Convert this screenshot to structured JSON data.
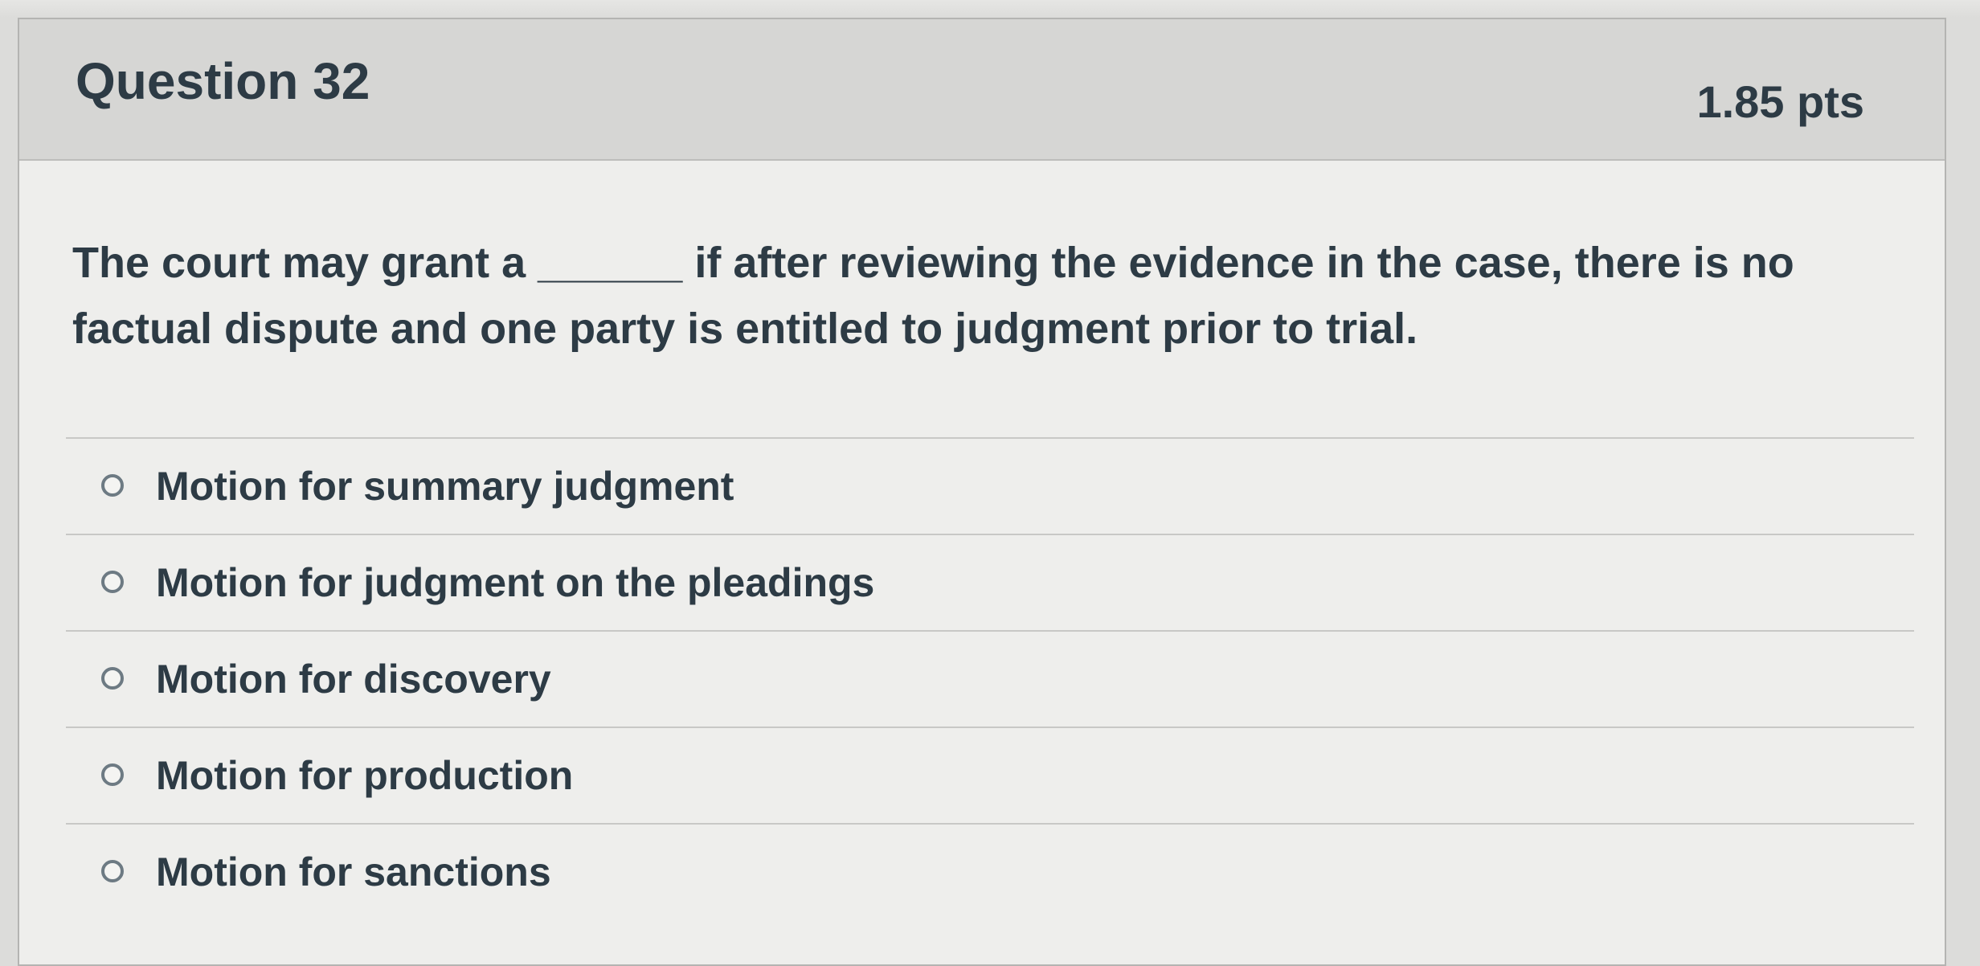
{
  "question": {
    "title": "Question 32",
    "points": "1.85 pts",
    "text": "The court may grant a ______ if after reviewing the evidence in the case, there is no factual dispute and one party is entitled to judgment prior to trial."
  },
  "answers": [
    {
      "label": "Motion for summary judgment"
    },
    {
      "label": "Motion for judgment on the pleadings"
    },
    {
      "label": "Motion for discovery"
    },
    {
      "label": "Motion for production"
    },
    {
      "label": "Motion for sanctions"
    }
  ]
}
